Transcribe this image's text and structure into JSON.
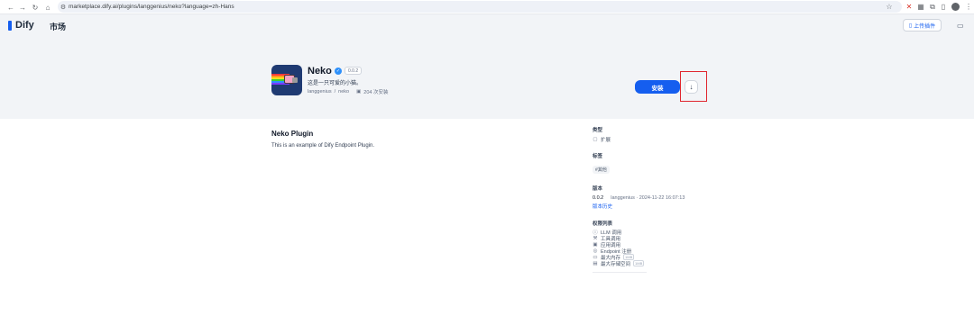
{
  "browser": {
    "url": "marketplace.dify.ai/plugins/langgenius/neko?language=zh-Hans",
    "back_icon": "arrow-left",
    "forward_icon": "arrow-right",
    "reload_icon": "reload",
    "home_icon": "home"
  },
  "header": {
    "logo_text": "Dify",
    "section_title": "市场",
    "upload_label": "上传插件"
  },
  "plugin": {
    "name": "Neko",
    "version": "0.0.2",
    "description": "这是一只可爱的小猫。",
    "author": "langgenius",
    "separator": "/",
    "slug": "neko",
    "installs": "204 次安装",
    "install_label": "安装",
    "download_icon": "↓"
  },
  "readme": {
    "title": "Neko Plugin",
    "text": "This is an example of Dify Endpoint Plugin."
  },
  "sidebar": {
    "category_heading": "类型",
    "category_value": "扩展",
    "tags_heading": "标签",
    "tag_value": "#其他",
    "version_heading": "版本",
    "version_value": "0.0.2",
    "version_meta": "langgenius · 2024-11-22 16:07:13",
    "version_history": "版本历史",
    "permissions_heading": "权限列表",
    "permissions": [
      {
        "icon": "circle-icon",
        "glyph": "ⓘ",
        "label": "LLM 调用",
        "badge": ""
      },
      {
        "icon": "tool-icon",
        "glyph": "⚒",
        "label": "工具调用",
        "badge": ""
      },
      {
        "icon": "app-icon",
        "glyph": "▣",
        "label": "应用调用",
        "badge": ""
      },
      {
        "icon": "endpoint-icon",
        "glyph": "◎",
        "label": "Endpoint 注册",
        "badge": ""
      },
      {
        "icon": "memory-icon",
        "glyph": "▭",
        "label": "最大内存",
        "badge": "1MB"
      },
      {
        "icon": "storage-icon",
        "glyph": "▤",
        "label": "最大存储空间",
        "badge": "1MB"
      }
    ]
  },
  "colors": {
    "accent": "#155eef",
    "highlight": "#e0262f"
  }
}
